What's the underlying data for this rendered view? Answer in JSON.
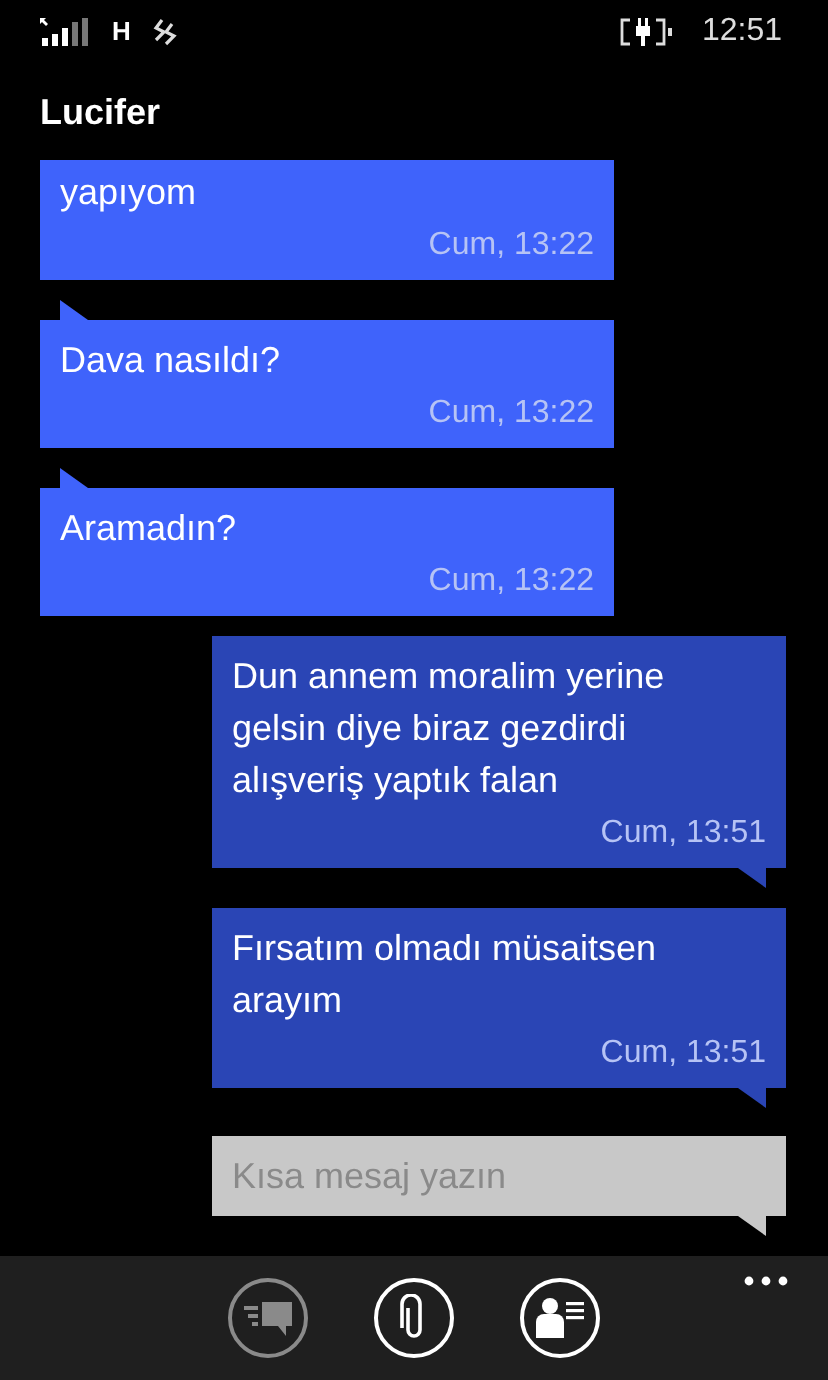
{
  "status_bar": {
    "network": "H",
    "time": "12:51"
  },
  "title": "Lucifer",
  "messages": [
    {
      "kind": "received",
      "text": "yapıyom",
      "time": "Cum, 13:22"
    },
    {
      "kind": "received",
      "text": "Dava nasıldı?",
      "time": "Cum, 13:22"
    },
    {
      "kind": "received",
      "text": "Aramadın?",
      "time": "Cum, 13:22"
    },
    {
      "kind": "sent",
      "text": "Dun annem moralim yerine gelsin diye biraz gezdirdi alışveriş yaptık falan",
      "time": "Cum, 13:51"
    },
    {
      "kind": "sent",
      "text": "Fırsatım olmadı müsaitsen arayım",
      "time": "Cum, 13:51"
    }
  ],
  "compose": {
    "placeholder": "Kısa mesaj yazın"
  },
  "app_bar": {
    "buttons": [
      {
        "kind": "send",
        "disabled": true
      },
      {
        "kind": "attach",
        "disabled": false
      },
      {
        "kind": "contact",
        "disabled": false
      }
    ]
  }
}
